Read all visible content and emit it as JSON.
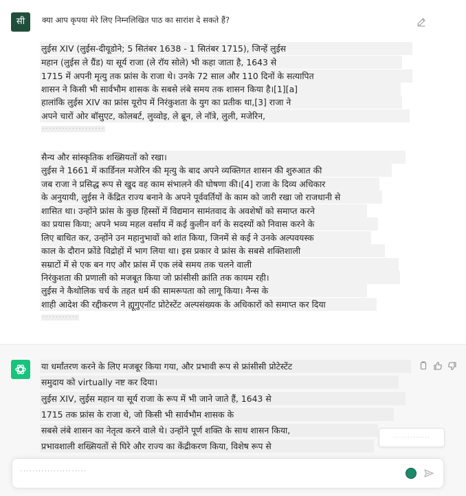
{
  "user": {
    "avatar_label": "सी",
    "question": "क्या आप कृपया मेरे लिए निम्नलिखित पाठ का सारांश दे सकते हैं?",
    "paragraph1": [
      "लुईस XIV (लुईस-दीयूडोने; 5 सितंबर 1638 - 1 सितंबर 1715), जिन्हें लुईस",
      " महान (लुईस ले ग्रैंड) या सूर्य राजा (ले रॉय सोले) भी कहा जाता है, 1643 से",
      "1715 में अपनी मृत्यु तक फ्रांस के राजा थे। उनके 72 साल और 110 दिनों के सत्यापित",
      "शासन ने किसी भी सार्वभौम शासक के सबसे लंबे समय तक शासन किया है।[1][a]",
      "हालांकि लुईस XIV का फ्रांस यूरोप में निरंकुशता के युग का प्रतीक था,[3] राजा ने",
      "अपने चारों ओर बॉसुएट, कोलबर्ट, लुव्वोइ, ले ब्रून, ले नॉत्रे, लुली, मजेरिन,"
    ],
    "paragraph1_small": "· · · · · · · · · · · · · · · · · · ·",
    "paragraph2": [
      "सैन्य और सांस्कृतिक शख्सियतों को रखा।",
      "लुईस ने 1661 में कार्डिनल मजेरिन की मृत्यु के बाद अपने व्यक्तिगत शासन की शुरुआत की",
      "जब राजा ने प्रसिद्ध रूप से खुद वह काम संभालने की घोषणा की।[4] राजा के दिव्य अधिकार",
      "के अनुयायी, लुईस ने केंद्रित राज्य बनाने के अपने पूर्ववर्तियों के काम को जारी रखा जो राजधानी से",
      "शासित था। उन्होंने फ्रांस के कुछ हिस्सों में विद्यमान सामंतवाद के अवशेषों को समाप्त करने",
      "का प्रयास किया; अपने भव्य महल वर्साय में कई कुलीन वर्ग के सदस्यों को निवास करने के",
      "लिए बाधित कर, उन्होंने उन महानुभावों को शांत किया, जिनमें से कई ने उनके अल्पवयस्क",
      "काल के दौरान फ्रोंडे विद्रोहों में भाग लिया था। इस प्रकार वे फ्रांस के सबसे शक्तिशाली",
      "सम्राटों में से एक बन गए और फ्रांस में एक लंबे समय तक चलने वाली",
      "निरंकुशता की प्रणाली को मजबूत किया जो फ्रांसीसी क्रांति तक कायम रही।",
      "लुईस ने कैथोलिक चर्च के तहत धर्म की सामरूपता को लागू किया। नैन्स के",
      "शाही आदेश की रद्दीकरण ने ह्यूगुएनॉट प्रोटेस्टेंट अल्पसंख्यक के अधिकारों को समाप्त कर दिया"
    ],
    "paragraph2_small": "· · · · · · · · · · ·"
  },
  "assistant": {
    "lines": [
      "या धर्मांतरण करने के लिए मजबूर किया गया, और प्रभावी रूप से फ्रांसीसी प्रोटेस्टेंट",
      "समुदाय को virtually नष्ट कर दिया।",
      "लुईस XIV, लुईस महान या सूर्य राजा के रूप में भी जाने जाते हैं, 1643 से",
      "1715 तक फ्रांस के राजा थे, जो किसी भी सार्वभौम शासक के",
      "सबसे लंबे शासन का नेतृत्व करने वाले थे। उन्होंने पूर्ण शक्ति के साथ शासन किया,",
      "प्रभावशाली शख्सियतों से घिरे और राज्य का केंद्रीकरण किया, विशेष रूप से"
    ],
    "floating_tag": "· · · · · · · · · · · · ·"
  },
  "composer": {
    "input_text": "· · · · · · · · · · · · · · · · · · · · · ·"
  },
  "icons": {
    "edit": "edit-icon",
    "copy": "copy-icon",
    "thumbs_up": "thumbs-up-icon",
    "thumbs_down": "thumbs-down-icon",
    "send": "send-icon",
    "bot_logo": "openai-logo-icon",
    "mic": "microphone-icon"
  },
  "colors": {
    "bot_avatar": "#19c37d",
    "user_avatar": "#1f4f3a"
  }
}
